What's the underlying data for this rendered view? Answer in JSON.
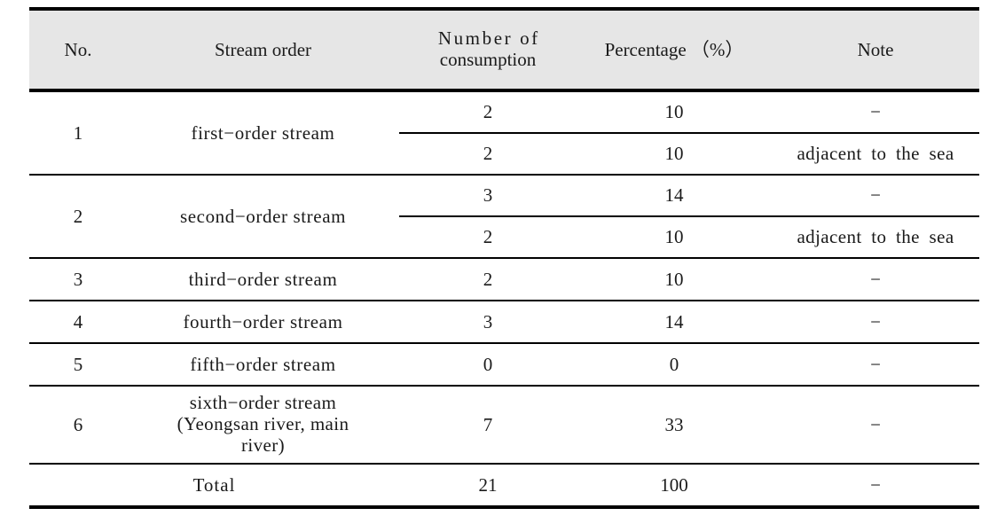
{
  "table": {
    "columns": [
      {
        "key": "no",
        "label": "No."
      },
      {
        "key": "order",
        "label_line1": "Number  of",
        "label": "Stream order"
      },
      {
        "key": "number",
        "label_line1": "Number  of",
        "label_line2": "consumption"
      },
      {
        "key": "percentage",
        "label": "Percentage （%）"
      },
      {
        "key": "note",
        "label": "Note"
      }
    ],
    "headers": {
      "no": "No.",
      "stream_order": "Stream order",
      "number_of_consumption_line1": "Number of",
      "number_of_consumption_line2": "consumption",
      "percentage": "Percentage （%）",
      "note": "Note"
    },
    "rows": [
      {
        "no": "1",
        "stream_order": "first−order stream",
        "subrows": [
          {
            "number": "2",
            "percentage": "10",
            "note": "−"
          },
          {
            "number": "2",
            "percentage": "10",
            "note": "adjacent to the sea"
          }
        ]
      },
      {
        "no": "2",
        "stream_order": "second−order stream",
        "subrows": [
          {
            "number": "3",
            "percentage": "14",
            "note": "−"
          },
          {
            "number": "2",
            "percentage": "10",
            "note": "adjacent to the sea"
          }
        ]
      },
      {
        "no": "3",
        "stream_order": "third−order stream",
        "subrows": [
          {
            "number": "2",
            "percentage": "10",
            "note": "−"
          }
        ]
      },
      {
        "no": "4",
        "stream_order": "fourth−order stream",
        "subrows": [
          {
            "number": "3",
            "percentage": "14",
            "note": "−"
          }
        ]
      },
      {
        "no": "5",
        "stream_order": "fifth−order stream",
        "subrows": [
          {
            "number": "0",
            "percentage": "0",
            "note": "−"
          }
        ]
      },
      {
        "no": "6",
        "stream_order_line1": "sixth−order stream",
        "stream_order_line2": "(Yeongsan river, main",
        "stream_order_line3": "river)",
        "subrows": [
          {
            "number": "7",
            "percentage": "33",
            "note": "−"
          }
        ]
      }
    ],
    "total": {
      "label": "Total",
      "number": "21",
      "percentage": "100",
      "note": "−"
    }
  },
  "style": {
    "header_background": "#e6e6e6",
    "rule_color": "#000000",
    "text_color": "#1a1a1a",
    "page_background": "#ffffff"
  }
}
